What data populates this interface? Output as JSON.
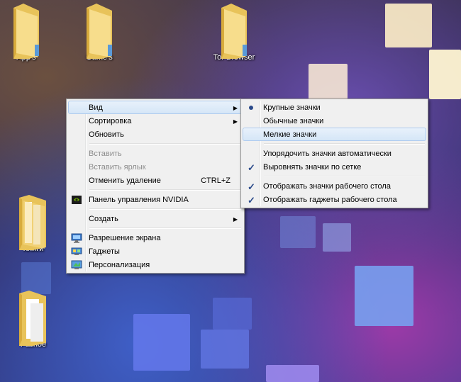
{
  "desktop": {
    "icons": [
      {
        "label": "App's"
      },
      {
        "label": "Game's"
      },
      {
        "label": "Tor Browser"
      },
      {
        "label": "Книги"
      },
      {
        "label": "Разное"
      }
    ]
  },
  "context_menu": {
    "view": "Вид",
    "sort": "Сортировка",
    "refresh": "Обновить",
    "paste": "Вставить",
    "paste_shortcut": "Вставить ярлык",
    "undo_delete": "Отменить удаление",
    "undo_delete_shortcut": "CTRL+Z",
    "nvidia": "Панель управления NVIDIA",
    "create": "Создать",
    "resolution": "Разрешение экрана",
    "gadgets": "Гаджеты",
    "personalization": "Персонализация"
  },
  "view_submenu": {
    "large_icons": "Крупные значки",
    "medium_icons": "Обычные значки",
    "small_icons": "Мелкие значки",
    "auto_arrange": "Упорядочить значки автоматически",
    "align_grid": "Выровнять значки по сетке",
    "show_icons": "Отображать значки рабочего стола",
    "show_gadgets": "Отображать гаджеты  рабочего стола"
  },
  "icons": {
    "folder": "folder-icon",
    "nvidia": "nvidia-icon",
    "display": "display-icon",
    "gadgets": "gadgets-icon",
    "personalize": "personalize-icon"
  },
  "colors": {
    "menu_bg": "#f0f0f0",
    "highlight": "#d5e6f7",
    "folder": "#f3d77a"
  }
}
